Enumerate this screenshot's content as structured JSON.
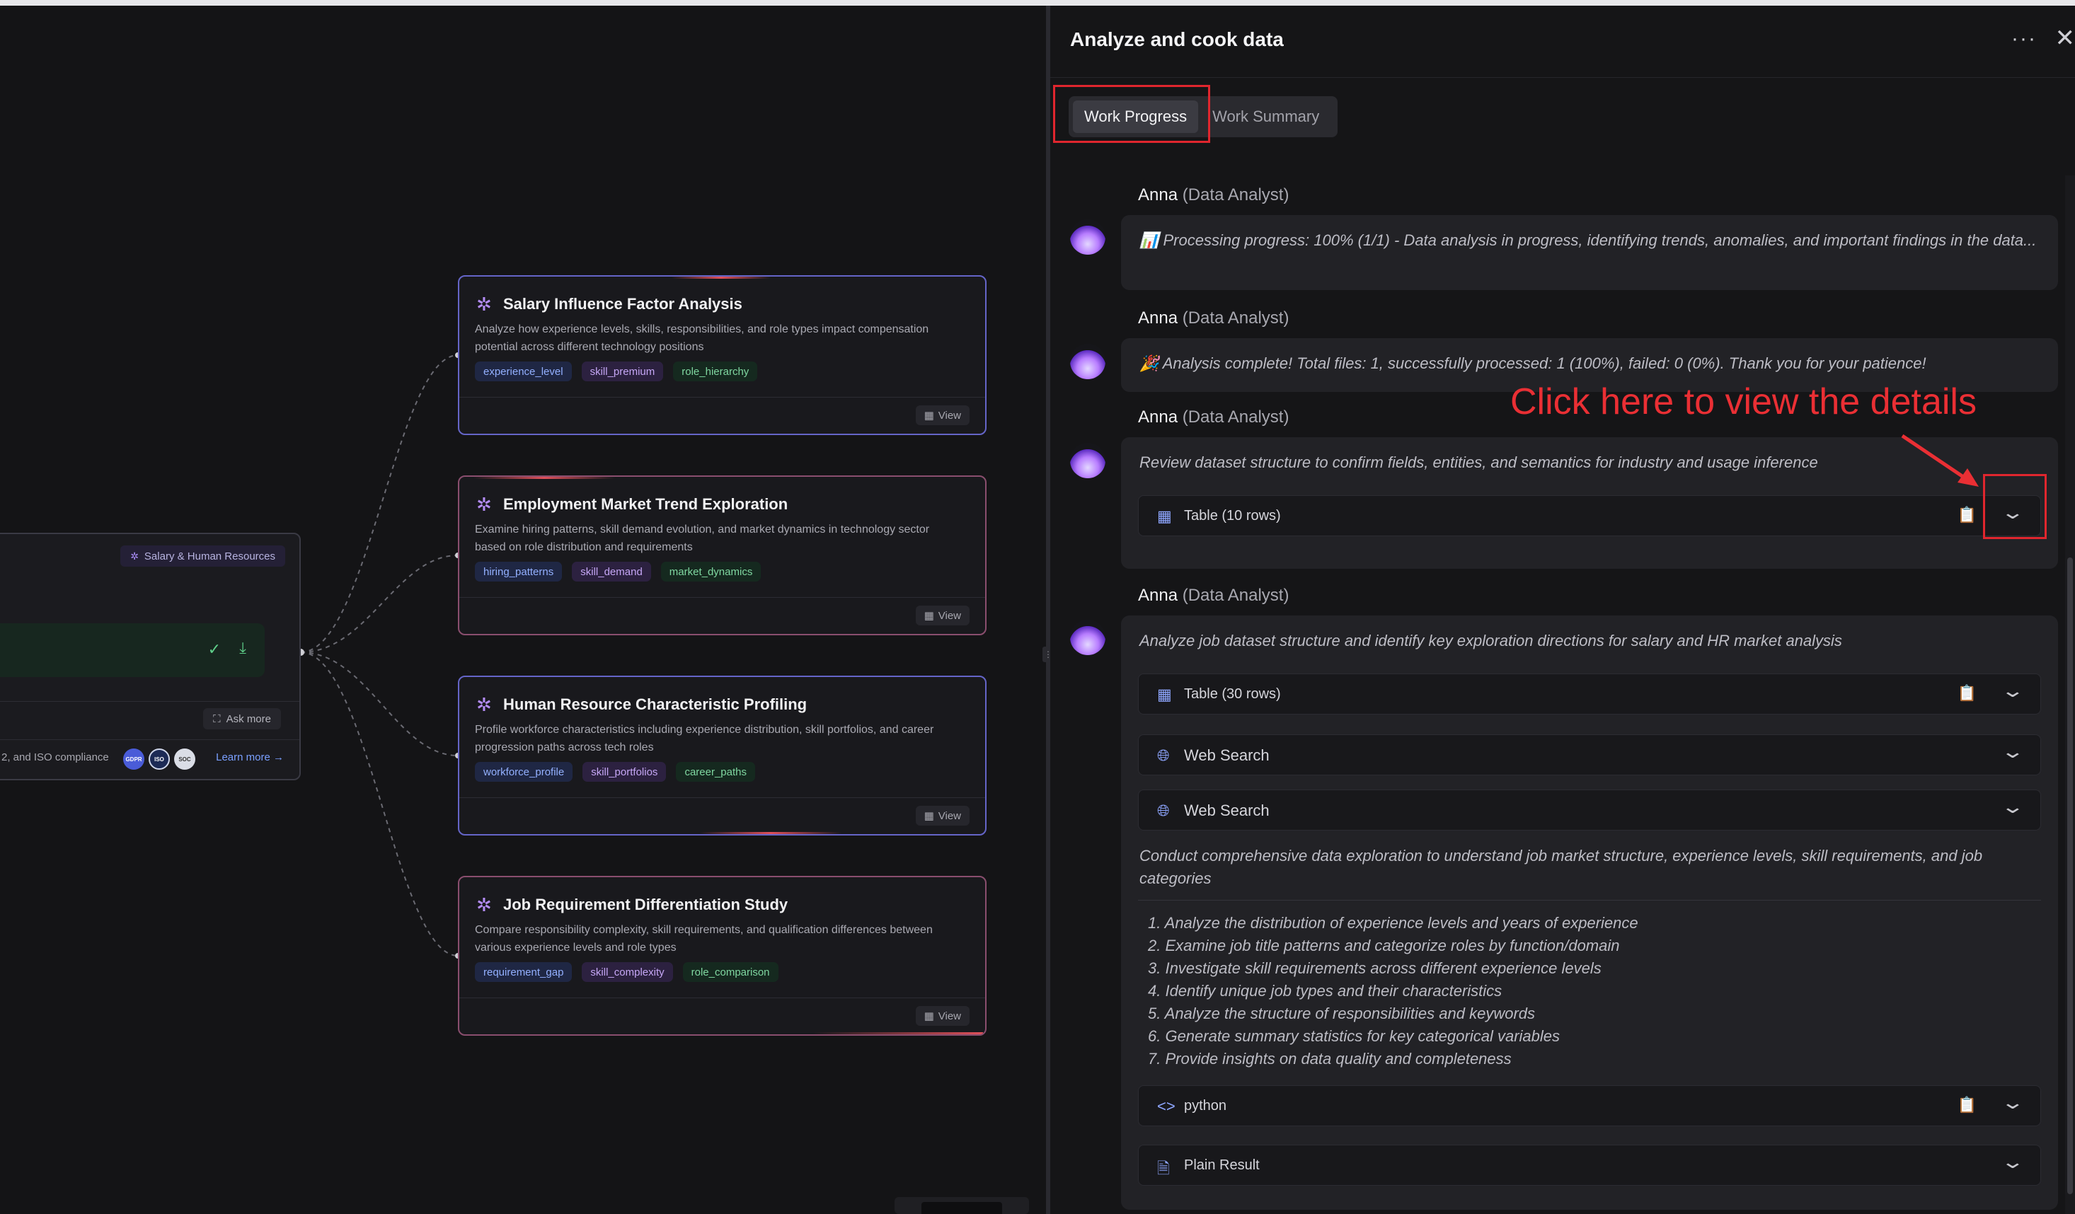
{
  "canvas": {
    "root": {
      "tag": "Salary & Human Resources",
      "ask_more": "Ask more",
      "compliance_text": "2, and ISO compliance",
      "badges": [
        "GDPR",
        "ISO",
        "SOC"
      ],
      "learn_more": "Learn more →"
    },
    "cards": [
      {
        "title": "Salary Influence Factor Analysis",
        "desc": "Analyze how experience levels, skills, responsibilities, and role types impact compensation potential across different technology positions",
        "tags": [
          "experience_level",
          "skill_premium",
          "role_hierarchy"
        ],
        "view": "View"
      },
      {
        "title": "Employment Market Trend Exploration",
        "desc": "Examine hiring patterns, skill demand evolution, and market dynamics in technology sector based on role distribution and requirements",
        "tags": [
          "hiring_patterns",
          "skill_demand",
          "market_dynamics"
        ],
        "view": "View"
      },
      {
        "title": "Human Resource Characteristic Profiling",
        "desc": "Profile workforce characteristics including experience distribution, skill portfolios, and career progression paths across tech roles",
        "tags": [
          "workforce_profile",
          "skill_portfolios",
          "career_paths"
        ],
        "view": "View"
      },
      {
        "title": "Job Requirement Differentiation Study",
        "desc": "Compare responsibility complexity, skill requirements, and qualification differences between various experience levels and role types",
        "tags": [
          "requirement_gap",
          "skill_complexity",
          "role_comparison"
        ],
        "view": "View"
      }
    ]
  },
  "panel": {
    "title": "Analyze and cook data",
    "tabs": [
      "Work Progress",
      "Work Summary"
    ],
    "annotation": "Click here to view the details",
    "messages": [
      {
        "author": "Anna",
        "role": "(Data Analyst)",
        "text": "📊 Processing progress: 100% (1/1) - Data analysis in progress, identifying trends, anomalies, and important findings in the data..."
      },
      {
        "author": "Anna",
        "role": "(Data Analyst)",
        "text": "🎉 Analysis complete! Total files: 1, successfully processed: 1 (100%), failed: 0 (0%). Thank you for your patience!"
      },
      {
        "author": "Anna",
        "role": "(Data Analyst)",
        "text": "Review dataset structure to confirm fields, entities, and semantics for industry and usage inference",
        "tool": "Table (10 rows)"
      },
      {
        "author": "Anna",
        "role": "(Data Analyst)",
        "text": "Analyze job dataset structure and identify key exploration directions for salary and HR market analysis",
        "tools": [
          "Table (30 rows)",
          "Web Search",
          "Web Search"
        ],
        "text2": "Conduct comprehensive data exploration to understand job market structure, experience levels, skill requirements, and job categories",
        "steps": [
          "1. Analyze the distribution of experience levels and years of experience",
          "2. Examine job title patterns and categorize roles by function/domain",
          "3. Investigate skill requirements across different experience levels",
          "4. Identify unique job types and their characteristics",
          "5. Analyze the structure of responsibilities and keywords",
          "6. Generate summary statistics for key categorical variables",
          "7. Provide insights on data quality and completeness"
        ],
        "tools2": [
          "python",
          "Plain Result"
        ]
      }
    ]
  },
  "colors": {
    "accent_red": "#e0262e",
    "brand_purple": "#a98cf5",
    "link_blue": "#7aa0ff"
  }
}
